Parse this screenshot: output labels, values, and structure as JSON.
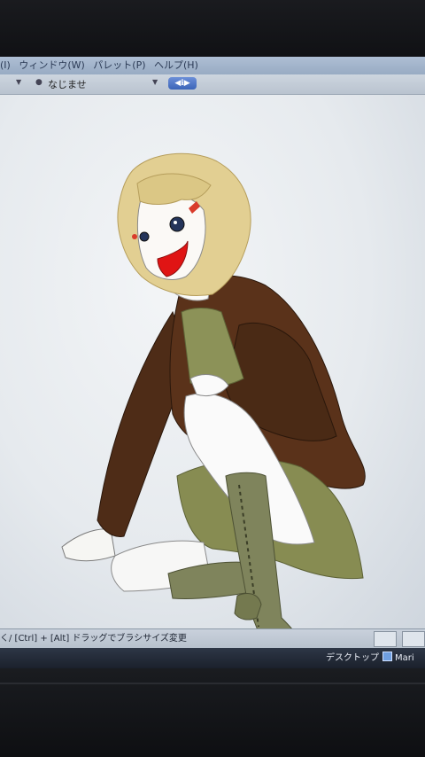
{
  "menubar": {
    "items": [
      "(I)",
      "ウィンドウ(W)",
      "パレット(P)",
      "ヘルプ(H)"
    ]
  },
  "toolbar": {
    "brush_label": "なじませ",
    "button_label": "◀ℹ▶"
  },
  "statusbar": {
    "hint": "く/ [Ctrl] + [Alt] ドラッグでブラシサイズ変更"
  },
  "taskbar": {
    "desktop_label": "デスクトップ",
    "app_label": "Mari"
  },
  "colors": {
    "hair": "#e2cf92",
    "jacket": "#4e2c17",
    "skirt": "#8c9258",
    "mouth": "#e01414",
    "menubar": "#a6b8cf"
  }
}
